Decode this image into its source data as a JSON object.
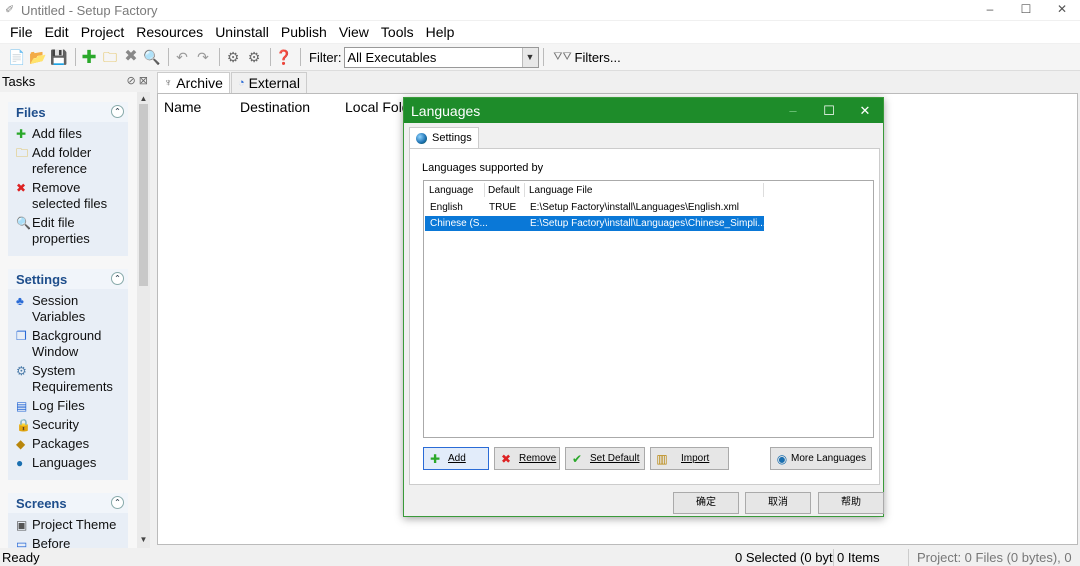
{
  "window": {
    "title": "Untitled - Setup Factory",
    "controls": [
      "–",
      "☐",
      "✕"
    ]
  },
  "menu": [
    "File",
    "Edit",
    "Project",
    "Resources",
    "Uninstall",
    "Publish",
    "View",
    "Tools",
    "Help"
  ],
  "toolbar": {
    "filter_label": "Filter:",
    "filter_value": "All Executables",
    "filters_label": "Filters..."
  },
  "tasks": {
    "header": "Tasks",
    "groups": [
      {
        "title": "Files",
        "items": [
          {
            "label": "Add files",
            "icon": "add-icon"
          },
          {
            "label": "Add folder reference",
            "icon": "folder-add-icon"
          },
          {
            "label": "Remove selected files",
            "icon": "remove-icon"
          },
          {
            "label": "Edit file properties",
            "icon": "properties-icon"
          }
        ]
      },
      {
        "title": "Settings",
        "items": [
          {
            "label": "Session Variables",
            "icon": "variables-icon"
          },
          {
            "label": "Background Window",
            "icon": "window-icon"
          },
          {
            "label": "System Requirements",
            "icon": "requirements-icon"
          },
          {
            "label": "Log Files",
            "icon": "log-icon"
          },
          {
            "label": "Security",
            "icon": "lock-icon"
          },
          {
            "label": "Packages",
            "icon": "packages-icon"
          },
          {
            "label": "Languages",
            "icon": "globe-icon"
          }
        ]
      },
      {
        "title": "Screens",
        "items": [
          {
            "label": "Project Theme",
            "icon": "theme-icon"
          },
          {
            "label": "Before",
            "icon": "screen-icon"
          }
        ]
      }
    ]
  },
  "main": {
    "tabs": [
      "Archive",
      "External"
    ],
    "columns": [
      "Name",
      "Destination",
      "Local Fold"
    ]
  },
  "status": {
    "left": "Ready",
    "selected": "0 Selected (0 byt",
    "items": "0 Items",
    "project": "Project: 0 Files (0 bytes), 0"
  },
  "dialog": {
    "title": "Languages",
    "tab": "Settings",
    "caption": "Languages supported by",
    "columns": [
      "Language",
      "Default",
      "Language File"
    ],
    "rows": [
      {
        "language": "English",
        "default": "TRUE",
        "file": "E:\\Setup Factory\\install\\Languages\\English.xml",
        "selected": false
      },
      {
        "language": "Chinese (S...",
        "default": "",
        "file": "E:\\Setup Factory\\install\\Languages\\Chinese_Simpli...",
        "selected": true
      }
    ],
    "buttons": {
      "add": "Add",
      "remove": "Remove",
      "set_default": "Set Default",
      "import": "Import",
      "more": "More Languages"
    },
    "footer": {
      "ok": "确定",
      "cancel": "取消",
      "help": "帮助"
    }
  },
  "colors": {
    "dialog_title_bg": "#1e8c2a",
    "selection": "#0a78d7",
    "task_header": "#1e4e8c"
  }
}
